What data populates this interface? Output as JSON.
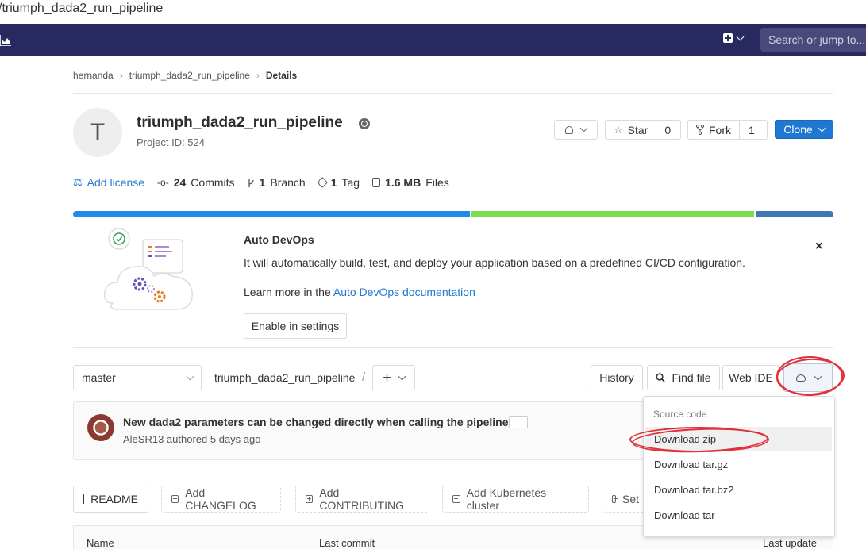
{
  "browser": {
    "url": "/triumph_dada2_run_pipeline"
  },
  "navbar": {
    "search_placeholder": "Search or jump to..."
  },
  "breadcrumb": {
    "items": [
      "hernanda",
      "triumph_dada2_run_pipeline",
      "Details"
    ]
  },
  "project": {
    "avatar_letter": "T",
    "title": "triumph_dada2_run_pipeline",
    "project_id": "Project ID: 524",
    "star_label": "Star",
    "star_count": "0",
    "fork_label": "Fork",
    "fork_count": "1",
    "clone_label": "Clone"
  },
  "stats": {
    "add_license": "Add license",
    "commits_count": "24",
    "commits_label": "Commits",
    "branch_count": "1",
    "branch_label": "Branch",
    "tag_count": "1",
    "tag_label": "Tag",
    "files_size": "1.6 MB",
    "files_label": "Files"
  },
  "language_bar": {
    "colors": [
      "#1f8ceb",
      "#7ddc4f",
      "#4078b4"
    ]
  },
  "autodevops": {
    "title": "Auto DevOps",
    "description": "It will automatically build, test, and deploy your application based on a predefined CI/CD configuration.",
    "learn_prefix": "Learn more in the",
    "learn_link": "Auto DevOps documentation",
    "enable_button": "Enable in settings",
    "close": "×"
  },
  "tree": {
    "branch": "master",
    "path": "triumph_dada2_run_pipeline",
    "path_sep": "/",
    "add": "+",
    "history": "History",
    "find_file": "Find file",
    "web_ide": "Web IDE"
  },
  "commit": {
    "title": "New dada2 parameters can be changed directly when calling the pipeline....",
    "ellipsis": "···",
    "meta": "AleSR13 authored 5 days ago"
  },
  "actions": {
    "readme": "README",
    "add_changelog": "Add CHANGELOG",
    "add_contributing": "Add CONTRIBUTING",
    "add_k8s": "Add Kubernetes cluster",
    "set_partial": "Set"
  },
  "table_headers": {
    "name": "Name",
    "last_commit": "Last commit",
    "last_update": "Last update"
  },
  "download_menu": {
    "header": "Source code",
    "items": [
      "Download zip",
      "Download tar.gz",
      "Download tar.bz2",
      "Download tar"
    ]
  }
}
